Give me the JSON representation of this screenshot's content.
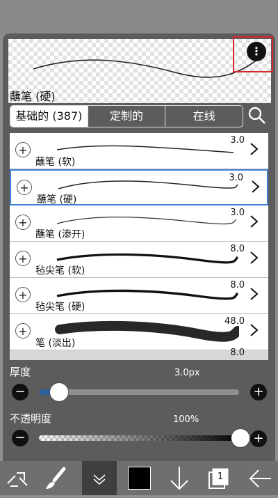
{
  "header": {
    "brush_name": "蘸笔 (硬)"
  },
  "tabs": [
    {
      "label": "基础的 (387)"
    },
    {
      "label": "定制的"
    },
    {
      "label": "在线"
    }
  ],
  "brushes": [
    {
      "name": "蘸笔 (软)",
      "size": "3.0"
    },
    {
      "name": "蘸笔 (硬)",
      "size": "3.0"
    },
    {
      "name": "蘸笔 (渗开)",
      "size": "3.0"
    },
    {
      "name": "毡尖笔 (软)",
      "size": "8.0"
    },
    {
      "name": "毡尖笔 (硬)",
      "size": "8.0"
    },
    {
      "name": "笔 (淡出)",
      "size": "48.0"
    },
    {
      "name": "",
      "size": "8.0"
    }
  ],
  "thickness": {
    "label": "厚度",
    "value": "3.0px",
    "level": 0.1
  },
  "opacity": {
    "label": "不透明度",
    "value": "100%",
    "level": 1.0
  },
  "colors": {
    "accent": "#3b7fd6",
    "highlight": "#d9262d",
    "current_color": "#000000"
  },
  "toolbar": {
    "layer_count": "1",
    "icons": [
      "transform-icon",
      "brush-icon",
      "collapse-icon",
      "color-swatch",
      "down-arrow-icon",
      "layers-icon",
      "back-arrow-icon"
    ]
  }
}
